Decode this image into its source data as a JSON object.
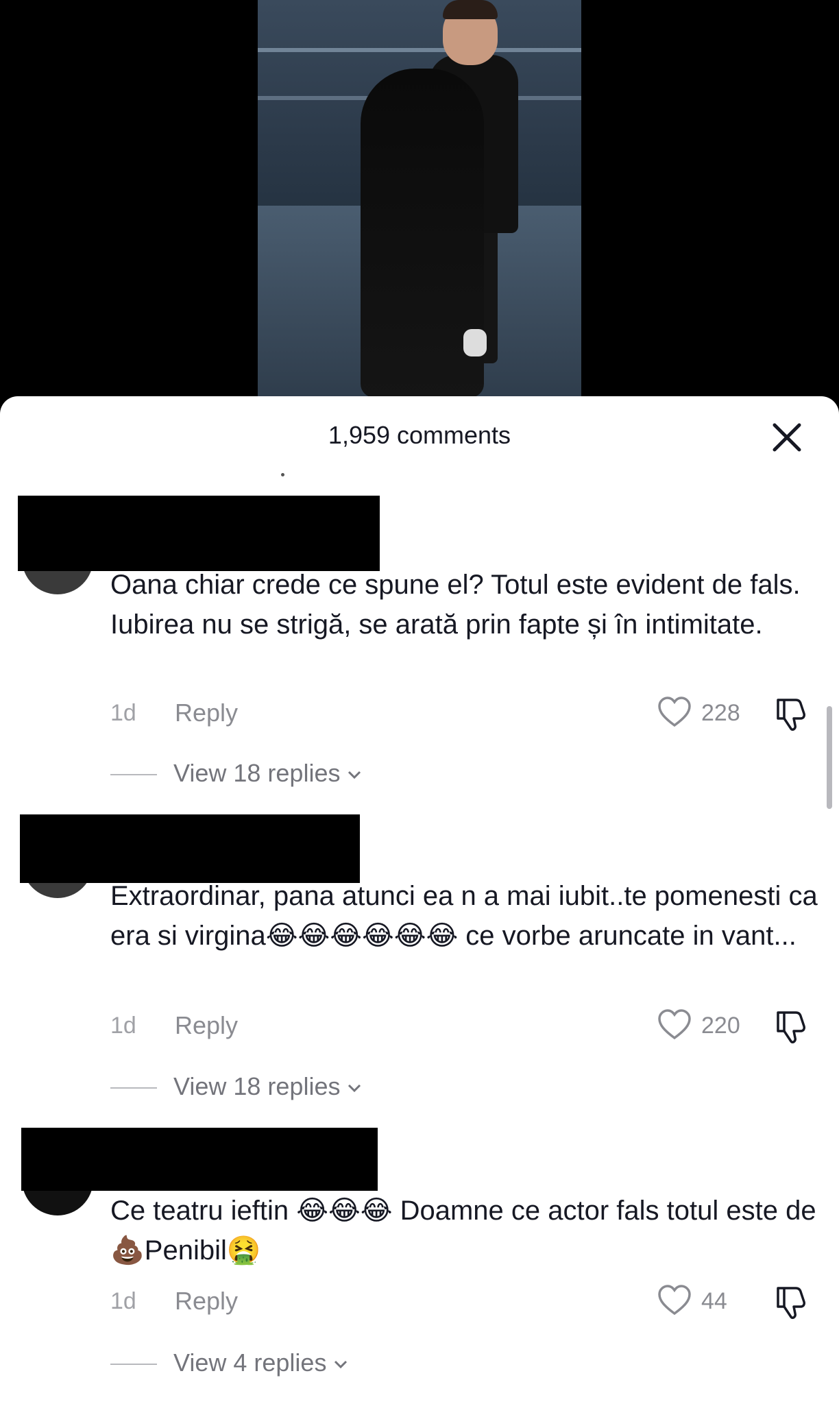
{
  "header": {
    "comments_count": "1,959 comments"
  },
  "comments": [
    {
      "text": "Oana chiar crede ce spune el? Totul este evident de fals. Iubirea nu se strigă, se arată prin fapte și în intimitate.",
      "time": "1d",
      "reply_label": "Reply",
      "likes": "228",
      "view_replies": "View 18 replies"
    },
    {
      "text": "Extraordinar, pana atunci ea n a mai iubit..te pomenesti ca era si virgina😂😂😂😂😂😂 ce vorbe aruncate in vant...",
      "time": "1d",
      "reply_label": "Reply",
      "likes": "220",
      "view_replies": "View 18 replies"
    },
    {
      "text": "Ce teatru ieftin 😂😂😂 Doamne ce actor fals totul este de 💩Penibil🤮",
      "time": "1d",
      "reply_label": "Reply",
      "likes": "44",
      "view_replies": "View 4 replies"
    }
  ],
  "icons": {
    "close": "close-icon",
    "like": "heart-icon",
    "dislike": "thumbs-down-icon",
    "chevron": "chevron-down-icon"
  },
  "colors": {
    "text_primary": "#161823",
    "text_secondary": "#8a8b91",
    "sheet_background": "#ffffff"
  }
}
